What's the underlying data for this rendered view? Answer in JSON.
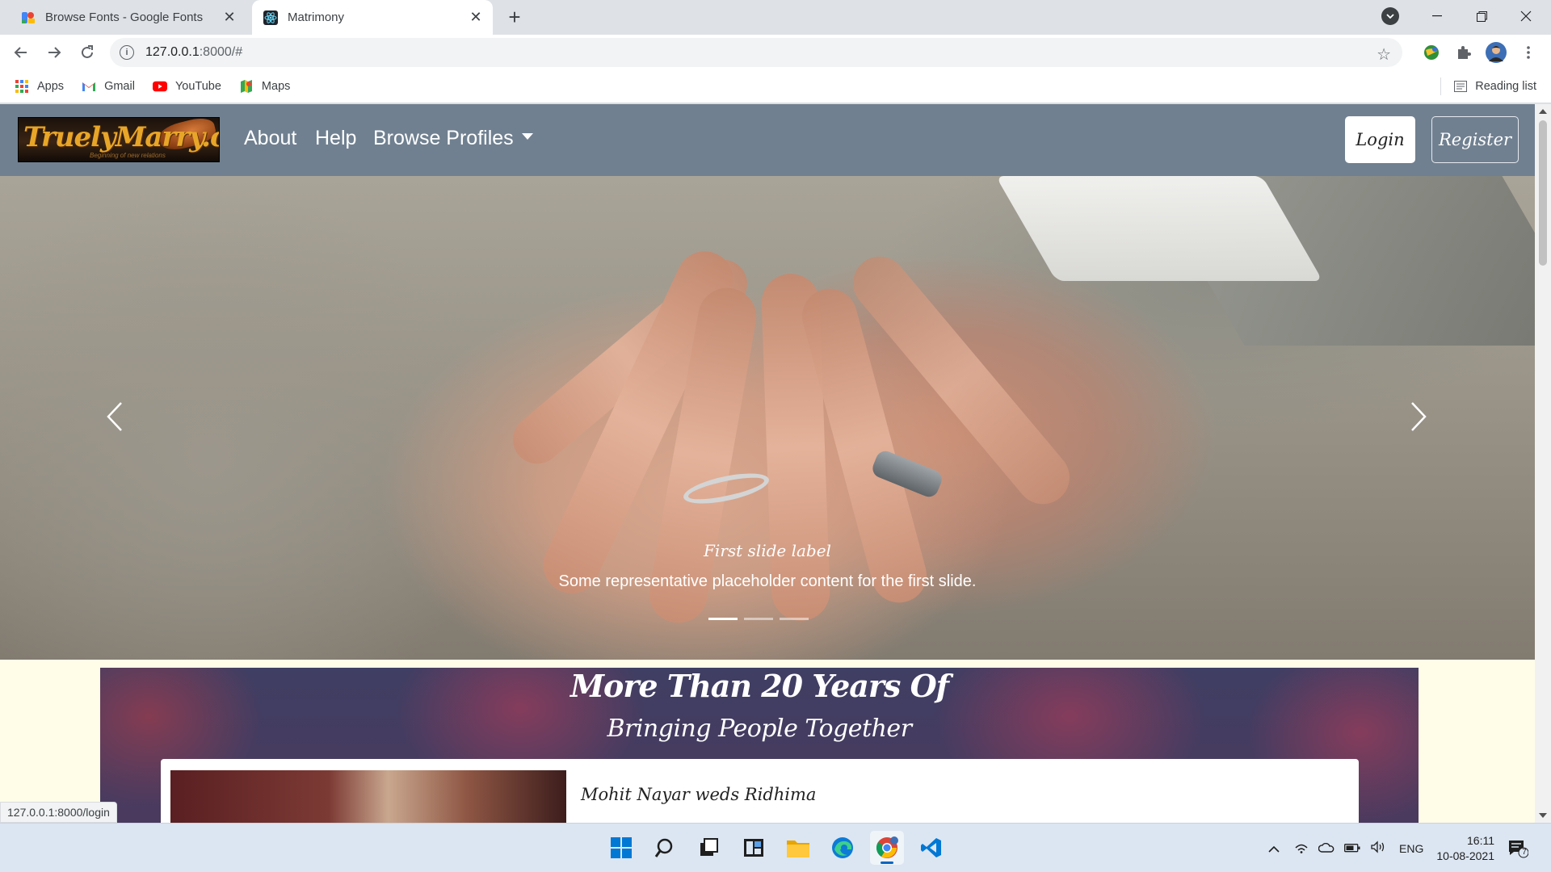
{
  "browser": {
    "tabs": [
      {
        "title": "Browse Fonts - Google Fonts",
        "active": false,
        "favicon": "google-fonts-icon"
      },
      {
        "title": "Matrimony",
        "active": true,
        "favicon": "react-icon"
      }
    ],
    "address": {
      "host": "127.0.0.1",
      "path": ":8000/#"
    },
    "bookmarks": [
      {
        "label": "Apps",
        "icon": "apps-grid-icon"
      },
      {
        "label": "Gmail",
        "icon": "gmail-icon"
      },
      {
        "label": "YouTube",
        "icon": "youtube-icon"
      },
      {
        "label": "Maps",
        "icon": "maps-icon"
      }
    ],
    "reading_list": "Reading list",
    "status_url": "127.0.0.1:8000/login"
  },
  "site": {
    "brand": {
      "logo_text": "TruelyMarry.com",
      "logo_tagline": "Beginning of new relations"
    },
    "nav": {
      "about": "About",
      "help": "Help",
      "browse": "Browse Profiles"
    },
    "login": "Login",
    "register": "Register",
    "nav_color": "#708090"
  },
  "carousel": {
    "caption_title": "First slide label",
    "caption_text": "Some representative placeholder content for the first slide.",
    "slides": 3,
    "active_slide": 1
  },
  "section": {
    "title": "More Than 20 Years Of",
    "subtitle": "Bringing People Together",
    "card_title": "Mohit Nayar weds Ridhima"
  },
  "taskbar": {
    "apps": [
      "start-icon",
      "search-icon",
      "task-view-icon",
      "widgets-icon",
      "file-explorer-icon",
      "edge-icon",
      "chrome-icon",
      "vscode-icon"
    ],
    "language": "ENG",
    "time": "16:11",
    "date": "10-08-2021",
    "notifications": "7"
  }
}
